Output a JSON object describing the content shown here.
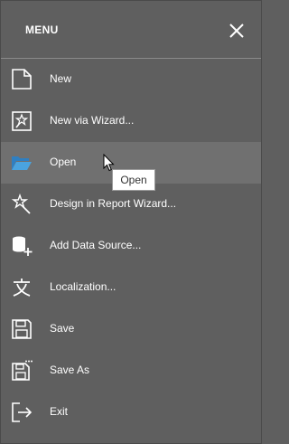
{
  "header": {
    "title": "MENU",
    "close_icon": "close-icon"
  },
  "items": [
    {
      "label": "New",
      "icon": "new-document-icon"
    },
    {
      "label": "New via Wizard...",
      "icon": "document-wizard-icon"
    },
    {
      "label": "Open",
      "icon": "folder-open-icon",
      "active": true
    },
    {
      "label": "Design in Report Wizard...",
      "icon": "magic-wand-icon"
    },
    {
      "label": "Add Data Source...",
      "icon": "database-add-icon"
    },
    {
      "label": "Localization...",
      "icon": "localization-icon"
    },
    {
      "label": "Save",
      "icon": "save-icon"
    },
    {
      "label": "Save As",
      "icon": "save-as-icon"
    },
    {
      "label": "Exit",
      "icon": "exit-icon"
    }
  ],
  "tooltip": {
    "text": "Open"
  },
  "colors": {
    "background": "#5f5f5f",
    "active_row": "#707070",
    "accent_folder": "#4aa3df",
    "text": "#ffffff"
  }
}
